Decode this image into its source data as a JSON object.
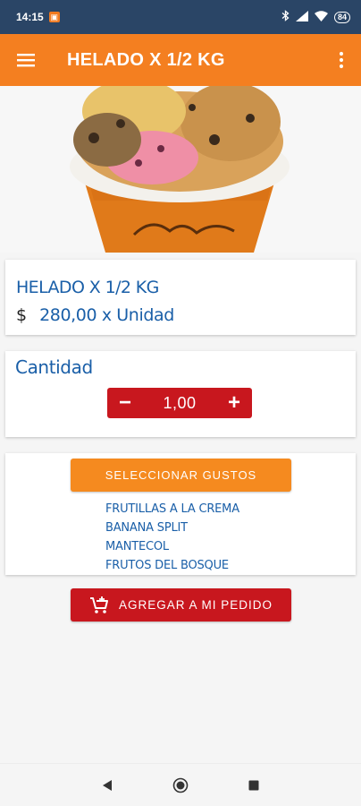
{
  "status": {
    "time": "14:15",
    "battery": "84"
  },
  "appbar": {
    "title": "HELADO X 1/2 KG"
  },
  "product": {
    "name": "HELADO X 1/2 KG",
    "currency": "$",
    "price": "280,00 x Unidad"
  },
  "quantity": {
    "label": "Cantidad",
    "value": "1,00",
    "minus": "−",
    "plus": "+"
  },
  "flavors": {
    "button_label": "SELECCIONAR GUSTOS",
    "items": [
      "FRUTILLAS A LA CREMA",
      "BANANA SPLIT",
      "MANTECOL",
      "FRUTOS DEL BOSQUE"
    ]
  },
  "add_button": {
    "label": "AGREGAR A MI PEDIDO"
  },
  "colors": {
    "statusbar": "#2a4566",
    "appbar": "#f47f20",
    "accent_blue": "#1a5fa8",
    "red": "#c8171e",
    "orange": "#f58a1f"
  },
  "icons": [
    "menu-icon",
    "more-vert-icon",
    "add-cart-icon",
    "back-icon",
    "home-icon",
    "recents-icon"
  ]
}
